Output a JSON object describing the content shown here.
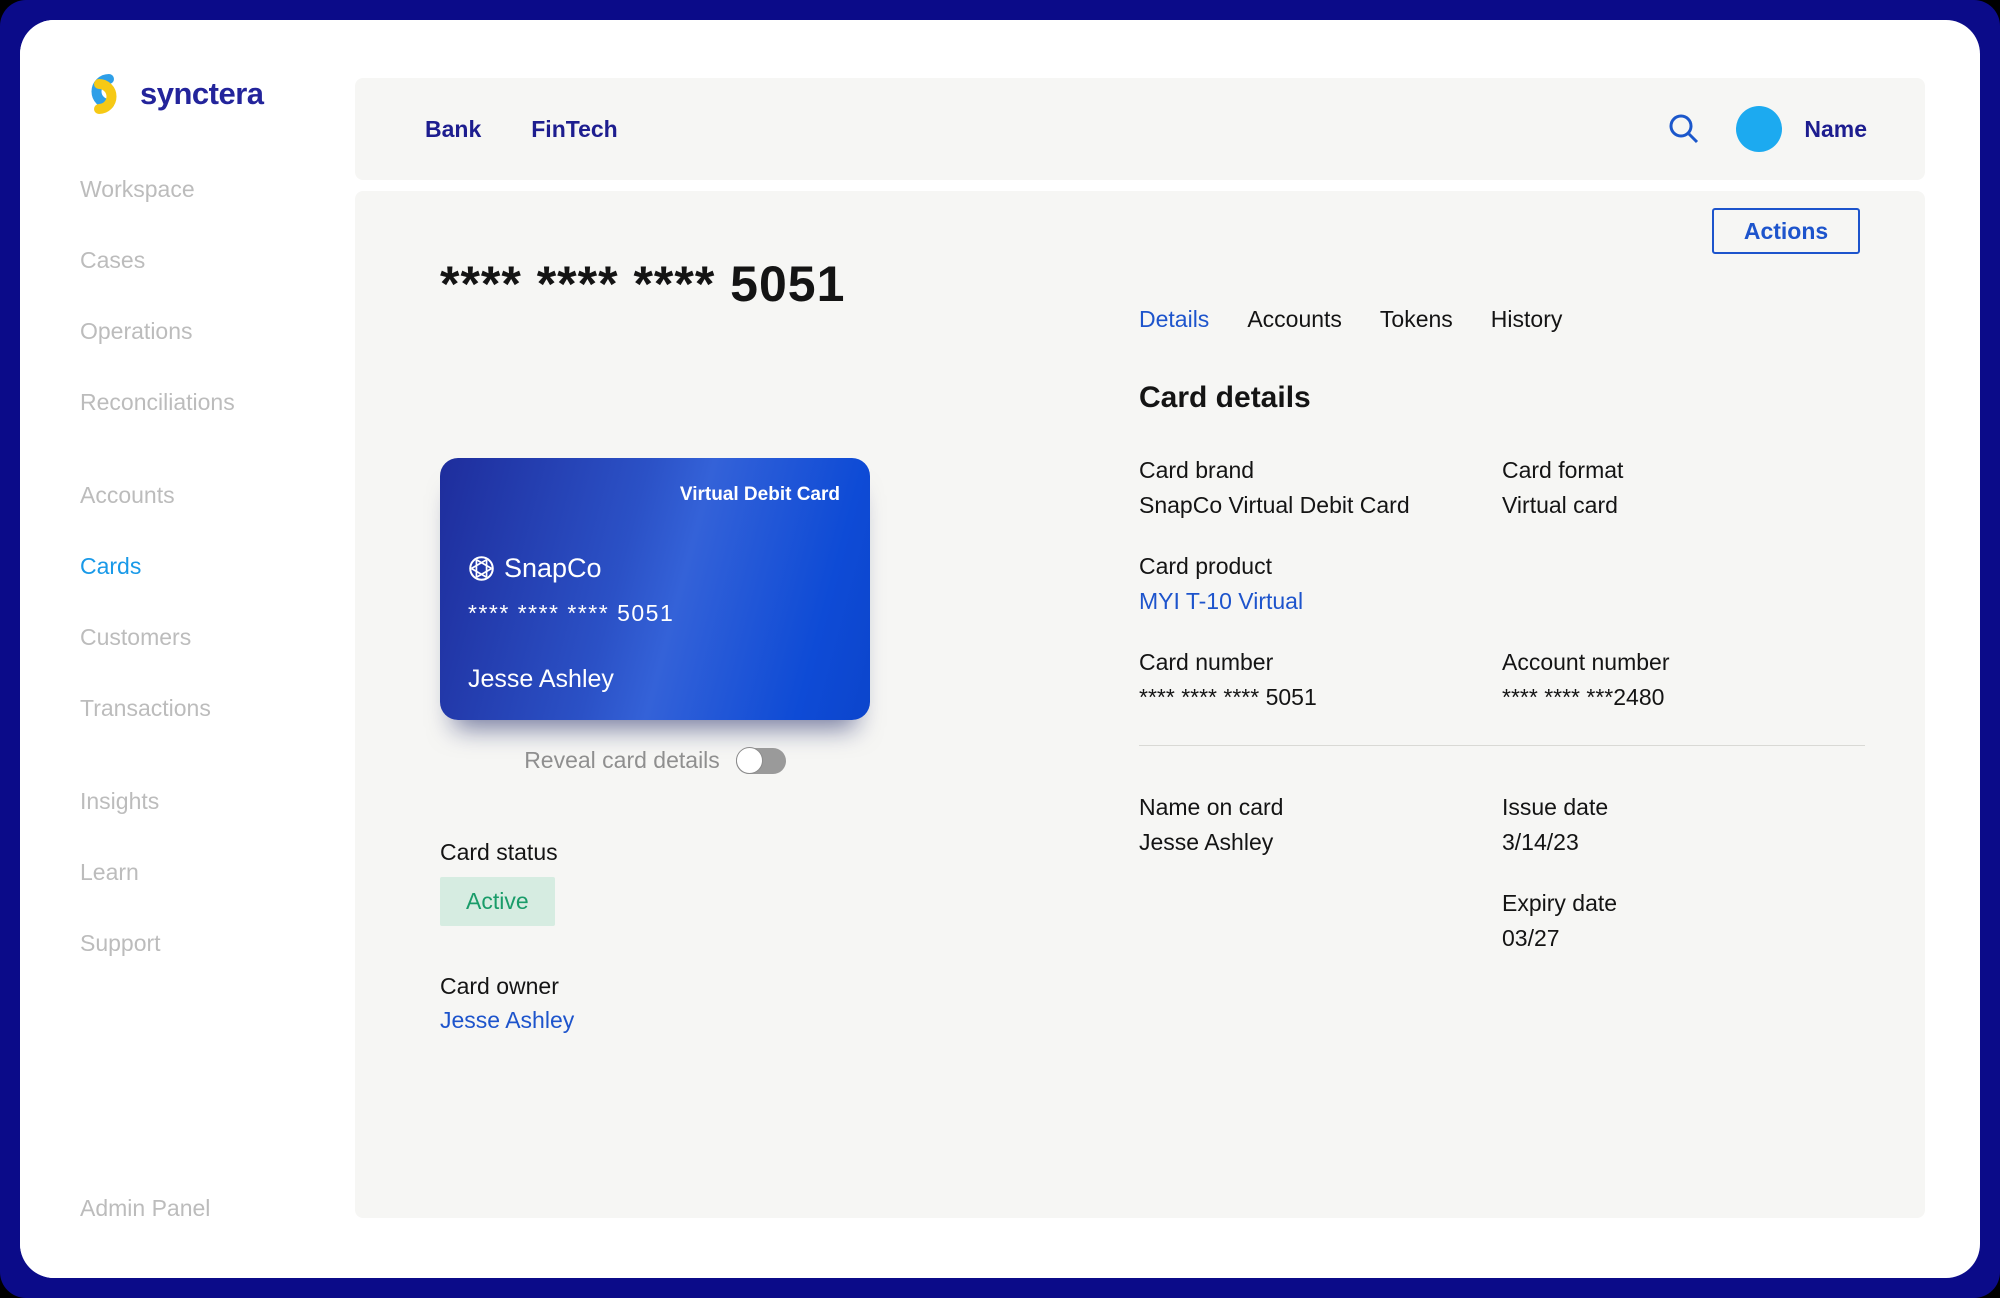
{
  "brand": {
    "name": "synctera"
  },
  "topbar": {
    "nav": [
      {
        "label": "Bank"
      },
      {
        "label": "FinTech"
      }
    ],
    "user_name": "Name"
  },
  "sidebar": {
    "items": [
      {
        "label": "Workspace"
      },
      {
        "label": "Cases"
      },
      {
        "label": "Operations"
      },
      {
        "label": "Reconciliations"
      },
      {
        "label": "Accounts"
      },
      {
        "label": "Cards",
        "active": true
      },
      {
        "label": "Customers"
      },
      {
        "label": "Transactions"
      },
      {
        "label": "Insights"
      },
      {
        "label": "Learn"
      },
      {
        "label": "Support"
      }
    ],
    "admin": {
      "label": "Admin Panel"
    }
  },
  "page": {
    "masked_heading": "**** **** **** 5051",
    "actions_button": "Actions"
  },
  "card_visual": {
    "type_label": "Virtual Debit Card",
    "brand_name": "SnapCo",
    "masked_number": "**** **** **** 5051",
    "holder_name": "Jesse Ashley"
  },
  "left_panel": {
    "reveal_toggle_label": "Reveal card details",
    "toggle_state": "off",
    "card_status_label": "Card status",
    "status_value": "Active",
    "card_owner_label": "Card owner",
    "card_owner_value": "Jesse Ashley"
  },
  "details_panel": {
    "tabs": [
      {
        "label": "Details",
        "active": true
      },
      {
        "label": "Accounts"
      },
      {
        "label": "Tokens"
      },
      {
        "label": "History"
      }
    ],
    "heading": "Card details",
    "fields": {
      "card_brand": {
        "label": "Card brand",
        "value": "SnapCo Virtual Debit Card"
      },
      "card_format": {
        "label": "Card format",
        "value": "Virtual card"
      },
      "card_product": {
        "label": "Card product",
        "value": "MYI T-10 Virtual"
      },
      "card_number": {
        "label": "Card number",
        "value": "**** **** **** 5051"
      },
      "account_number": {
        "label": "Account number",
        "value": "**** **** ***2480"
      },
      "name_on_card": {
        "label": "Name on card",
        "value": "Jesse Ashley"
      },
      "issue_date": {
        "label": "Issue date",
        "value": "3/14/23"
      },
      "expiry_date": {
        "label": "Expiry date",
        "value": "03/27"
      }
    }
  },
  "colors": {
    "frame_navy": "#0b0b89",
    "navy_text": "#1d1d8f",
    "link_blue": "#1d54cc",
    "sidebar_active_blue": "#1899e8",
    "avatar_blue": "#1caaf0",
    "status_green": "#199c69",
    "status_green_bg": "#d6ece1",
    "panel_gray": "#f6f6f4",
    "card_gradient_start": "#1e2d9c",
    "card_gradient_end": "#0c45cc"
  }
}
